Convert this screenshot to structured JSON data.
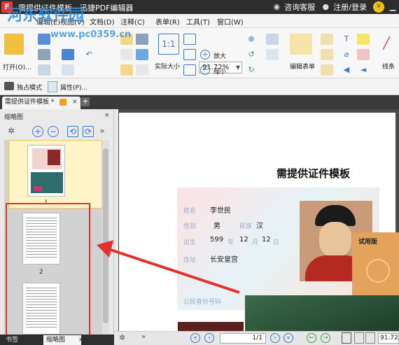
{
  "window": {
    "title": "需提供证件模板 - 迅捷PDF编辑器"
  },
  "titlebar": {
    "consult": "咨询客服",
    "register": "注册/登录",
    "coin": "¥"
  },
  "menu": {
    "items": [
      "编辑(E)",
      "视图(V)",
      "文档(D)",
      "注释(C)",
      "表单(R)",
      "工具(T)",
      "窗口(W)"
    ]
  },
  "watermark": {
    "text": "河东软件园",
    "url": "www.pc0359.cn"
  },
  "ribbon": {
    "open_label": "打开(O)...",
    "zoom_value": "91.72%",
    "actual_size": "实际大小",
    "zoom_in": "放大",
    "zoom_out": "缩小",
    "edit_form": "编辑表单",
    "line_tool": "线条"
  },
  "modebar": {
    "exclusive_mode": "独占模式",
    "properties": "属性(P)..."
  },
  "tabs": {
    "doc_tab": "需提供证件模板 *"
  },
  "panel": {
    "title": "缩略图",
    "pages": [
      "1",
      "2"
    ],
    "bottom_tabs": [
      "书签",
      "缩略图"
    ]
  },
  "document": {
    "title": "需提供证件模板",
    "card": {
      "name_label": "姓名",
      "name_value": "李世民",
      "sex_label": "性别",
      "sex_value": "男",
      "ethnic_label": "民族",
      "ethnic_value": "汉",
      "birth_label": "出生",
      "birth_year": "599",
      "year_unit": "年",
      "birth_month": "12",
      "month_unit": "月",
      "birth_day": "12",
      "day_unit": "日",
      "address_label": "住址",
      "address_value": "长安皇宫",
      "id_label": "公民身份号码"
    },
    "trial": {
      "label": "试用版"
    }
  },
  "status": {
    "page_input": "1",
    "page_total": "/1",
    "zoom": "91.72"
  }
}
